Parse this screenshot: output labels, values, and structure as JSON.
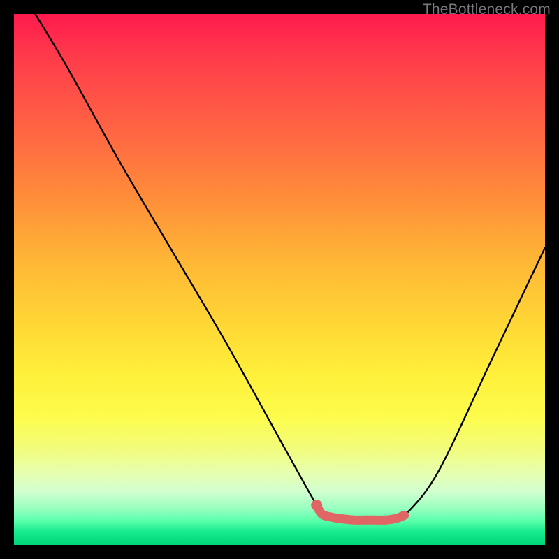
{
  "watermark": "TheBottleneck.com",
  "chart_data": {
    "type": "line",
    "title": "",
    "xlabel": "",
    "ylabel": "",
    "xlim": [
      0,
      100
    ],
    "ylim": [
      0,
      100
    ],
    "series": [
      {
        "name": "bottleneck-curve",
        "x": [
          4,
          10,
          20,
          30,
          40,
          50,
          55,
          57,
          58,
          60,
          65,
          70,
          72,
          74,
          80,
          90,
          100
        ],
        "y": [
          100,
          90,
          72,
          55,
          38,
          20,
          11,
          7.5,
          5.8,
          5,
          4.7,
          4.7,
          5,
          6,
          14,
          35,
          56
        ]
      }
    ],
    "markers": {
      "name": "highlight-band",
      "color": "#e06666",
      "points_x": [
        57,
        58,
        60,
        62,
        64,
        66,
        68,
        70,
        72,
        73.5
      ],
      "points_y": [
        7.5,
        5.8,
        5.2,
        4.9,
        4.7,
        4.7,
        4.7,
        4.7,
        5.0,
        5.6
      ]
    },
    "start_dot": {
      "x": 57,
      "y": 7.5,
      "color": "#e06666"
    }
  }
}
